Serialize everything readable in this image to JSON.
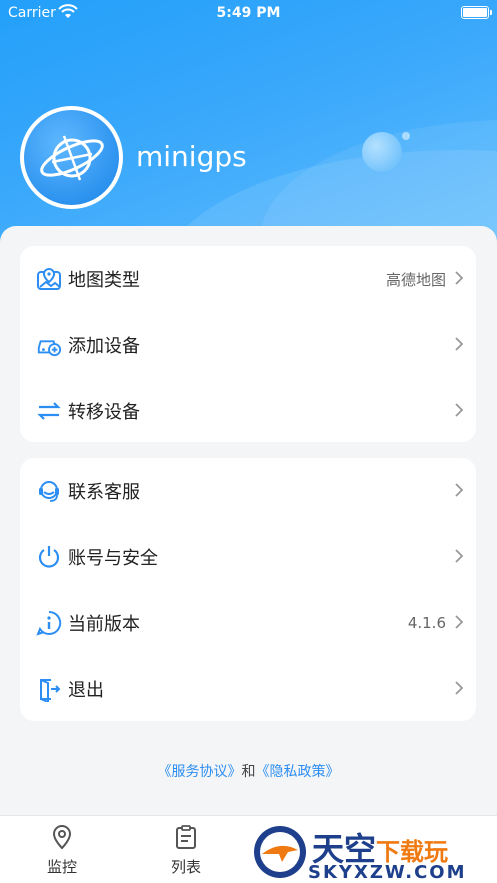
{
  "status_bar": {
    "carrier": "Carrier",
    "time": "5:49 PM"
  },
  "profile": {
    "app_name": "minigps"
  },
  "menu_group1": [
    {
      "label": "地图类型",
      "value": "高德地图",
      "icon": "map-pin-icon"
    },
    {
      "label": "添加设备",
      "icon": "car-add-icon"
    },
    {
      "label": "转移设备",
      "icon": "transfer-arrows-icon"
    }
  ],
  "menu_group2": [
    {
      "label": "联系客服",
      "icon": "headset-icon"
    },
    {
      "label": "账号与安全",
      "icon": "power-icon"
    },
    {
      "label": "当前版本",
      "value": "4.1.6",
      "icon": "info-icon"
    },
    {
      "label": "退出",
      "icon": "exit-door-icon"
    }
  ],
  "agreement": {
    "service": "《服务协议》",
    "and": "和",
    "privacy": "《隐私政策》"
  },
  "tabbar": {
    "tabs": [
      {
        "label": "监控",
        "icon": "location-pin-icon"
      },
      {
        "label": "列表",
        "icon": "clipboard-list-icon"
      }
    ]
  },
  "watermark": {
    "title_a": "天空",
    "title_b": "下载玩",
    "url": "SKYXZW.COM"
  },
  "colors": {
    "accent": "#2c8ef2",
    "header": "#2ea3fa"
  }
}
